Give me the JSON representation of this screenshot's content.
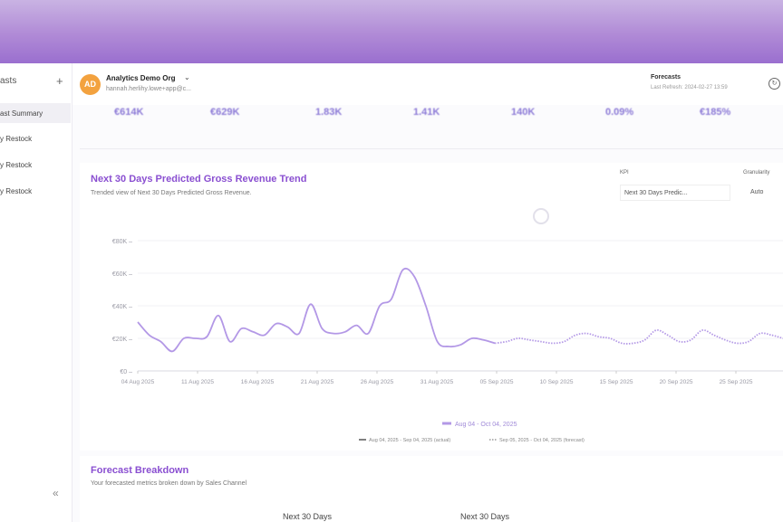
{
  "sidebar": {
    "title": "asts",
    "items": [
      {
        "label": "ast Summary",
        "active": true
      },
      {
        "label": "y Restock",
        "active": false
      },
      {
        "label": "y Restock",
        "active": false
      },
      {
        "label": "y Restock",
        "active": false
      }
    ],
    "collapse_icon": "double-chevron-left-icon"
  },
  "header": {
    "avatar_initials": "AD",
    "org_name": "Analytics Demo Org",
    "org_email": "hannah.herlihy.lowe+app@c...",
    "forecast_label": "Forecasts",
    "last_refresh": "Last Refresh: 2024-02-27 13:59"
  },
  "kpis": [
    "€614K",
    "€629K",
    "1.83K",
    "1.41K",
    "140K",
    "0.09%",
    "€185%"
  ],
  "trend_card": {
    "title": "Next 30 Days Predicted Gross Revenue Trend",
    "subtitle": "Trended view of Next 30 Days Predicted Gross Revenue.",
    "kpi_label": "KPI",
    "kpi_value": "Next 30 Days Predic...",
    "granularity_label": "Granularity",
    "granularity_value": "Auto"
  },
  "chart_data": {
    "type": "line",
    "ylim": [
      0,
      80000
    ],
    "y_ticks": [
      "€0",
      "€20K",
      "€40K",
      "€60K",
      "€80K"
    ],
    "x_ticks": [
      "04 Aug 2025",
      "11 Aug 2025",
      "16 Aug 2025",
      "21 Aug 2025",
      "26 Aug 2025",
      "31 Aug 2025",
      "05 Sep 2025",
      "10 Sep 2025",
      "15 Sep 2025",
      "20 Sep 2025",
      "25 Sep 2025"
    ],
    "range_label": "Aug 04 - Oct 04, 2025",
    "series": [
      {
        "name": "Aug 04, 2025 - Sep 04, 2025 (actual)",
        "style": "solid",
        "x": [
          0,
          1,
          2,
          3,
          4,
          5,
          6,
          7,
          8,
          9,
          10,
          11,
          12,
          13,
          14,
          15,
          16,
          17,
          18,
          19,
          20,
          21,
          22,
          23,
          24,
          25,
          26,
          27,
          28,
          29,
          30,
          31
        ],
        "values": [
          30000,
          22000,
          18000,
          12000,
          20000,
          20000,
          21000,
          34000,
          18000,
          26000,
          24000,
          22000,
          29000,
          27000,
          23000,
          41000,
          26000,
          23000,
          24000,
          28000,
          23000,
          40000,
          44000,
          62000,
          58000,
          40000,
          18000,
          15000,
          16000,
          20000,
          19000,
          17000
        ]
      },
      {
        "name": "Sep 05, 2025 - Oct 04, 2025 (forecast)",
        "style": "dotted",
        "x": [
          31,
          32,
          33,
          34,
          35,
          36,
          37,
          38,
          39,
          40,
          41,
          42,
          43,
          44,
          45,
          46,
          47,
          48,
          49,
          50,
          51,
          52,
          53,
          54,
          55,
          56
        ],
        "values": [
          17000,
          18000,
          20000,
          19000,
          18000,
          17000,
          18000,
          22000,
          23000,
          21000,
          20000,
          17000,
          17000,
          19000,
          25000,
          22000,
          18000,
          19000,
          25000,
          22000,
          19000,
          17000,
          18000,
          23000,
          22000,
          20000
        ]
      }
    ]
  },
  "breakdown_card": {
    "title": "Forecast Breakdown",
    "subtitle": "Your forecasted metrics broken down by Sales Channel",
    "columns": [
      "Next 30 Days",
      "Next 30 Days"
    ]
  },
  "colors": {
    "accent": "#8a4fd1",
    "line": "#b398e6",
    "avatar": "#f3a23f"
  }
}
